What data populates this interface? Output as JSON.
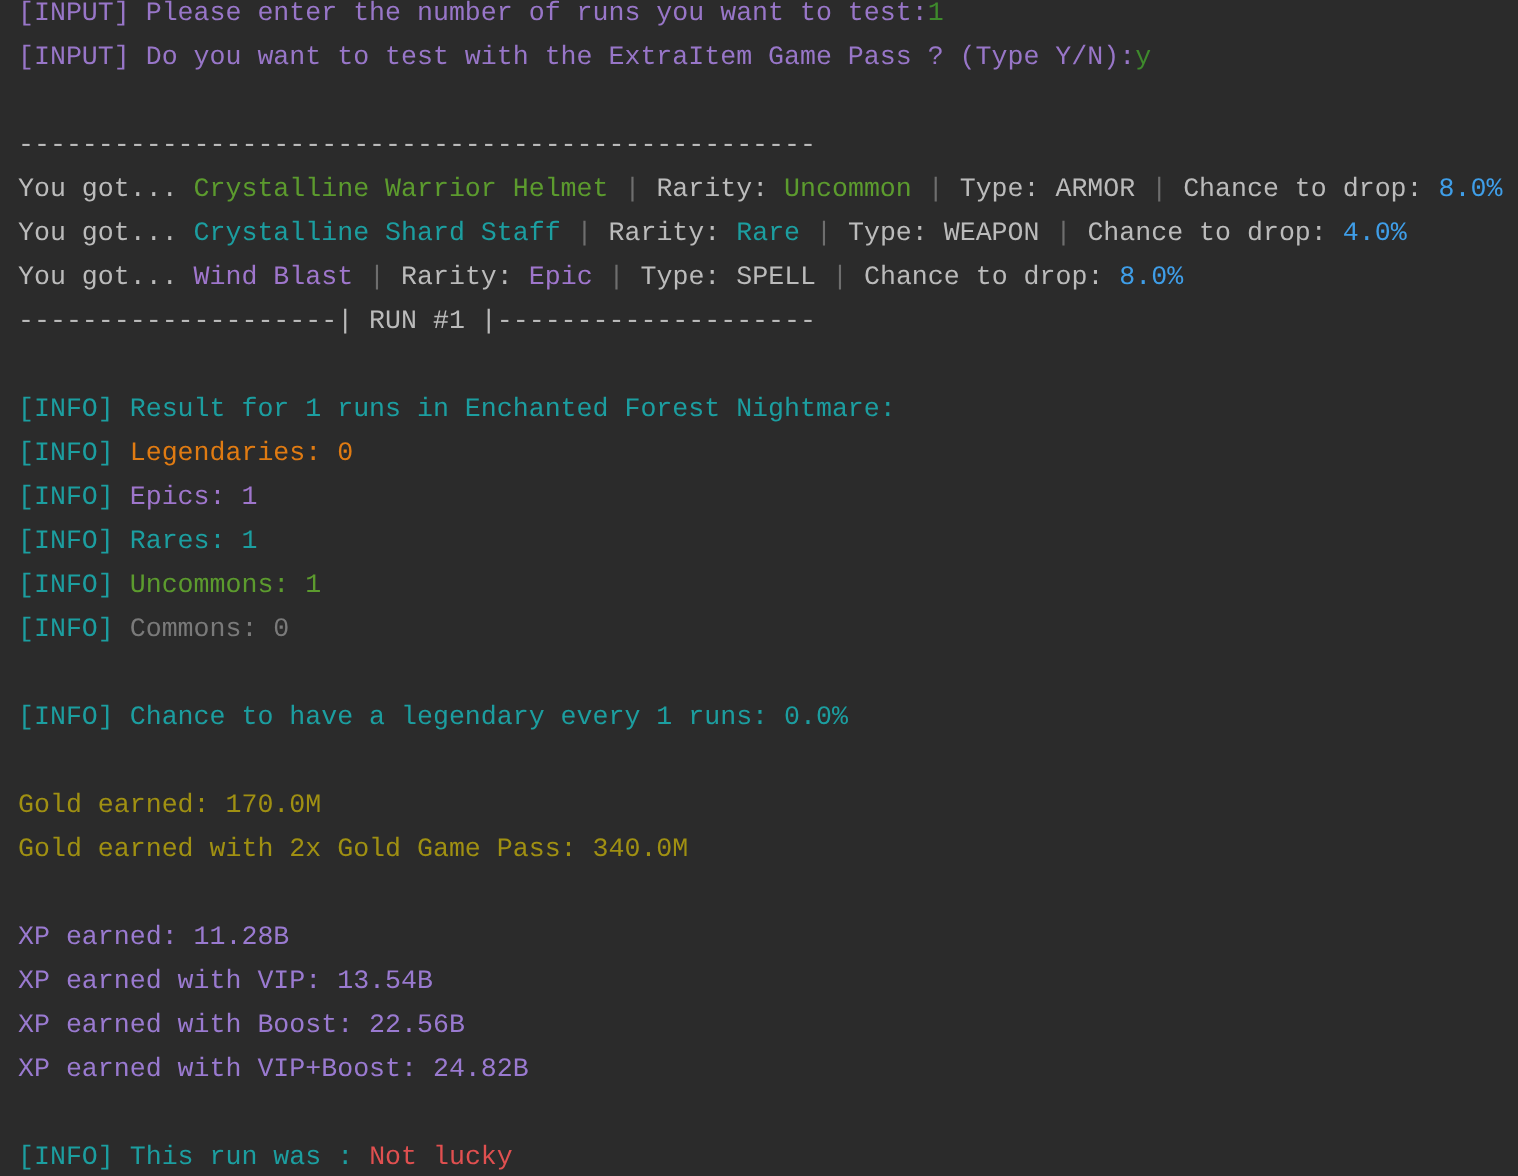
{
  "console": {
    "lines": [
      {
        "kind": "text",
        "segments": [
          {
            "text": "[INPUT] Please enter the number of runs you want to test:",
            "color": "#9876c8"
          },
          {
            "text": "1",
            "color": "#3e8a2c"
          }
        ]
      },
      {
        "kind": "text",
        "segments": [
          {
            "text": "[INPUT] Do you want to test with the ExtraItem Game Pass ? (Type Y/N):",
            "color": "#9876c8"
          },
          {
            "text": "y",
            "color": "#3e8a2c"
          }
        ]
      },
      {
        "kind": "blank"
      },
      {
        "kind": "text",
        "segments": [
          {
            "text": "--------------------------------------------------",
            "color": "#bbbbbb"
          }
        ]
      },
      {
        "kind": "text",
        "segments": [
          {
            "text": "You got... ",
            "color": "#bbbbbb"
          },
          {
            "text": "Crystalline Warrior Helmet",
            "color": "#5c9b2e"
          },
          {
            "text": " | ",
            "color": "#6e6e6e"
          },
          {
            "text": "Rarity: ",
            "color": "#bbbbbb"
          },
          {
            "text": "Uncommon",
            "color": "#5c9b2e"
          },
          {
            "text": " | ",
            "color": "#6e6e6e"
          },
          {
            "text": "Type: ARMOR",
            "color": "#bbbbbb"
          },
          {
            "text": " | ",
            "color": "#6e6e6e"
          },
          {
            "text": "Chance to drop: ",
            "color": "#bbbbbb"
          },
          {
            "text": "8.0%",
            "color": "#3f9ee8"
          }
        ]
      },
      {
        "kind": "text",
        "segments": [
          {
            "text": "You got... ",
            "color": "#bbbbbb"
          },
          {
            "text": "Crystalline Shard Staff",
            "color": "#1c9ea0"
          },
          {
            "text": " | ",
            "color": "#6e6e6e"
          },
          {
            "text": "Rarity: ",
            "color": "#bbbbbb"
          },
          {
            "text": "Rare",
            "color": "#1c9ea0"
          },
          {
            "text": " | ",
            "color": "#6e6e6e"
          },
          {
            "text": "Type: WEAPON",
            "color": "#bbbbbb"
          },
          {
            "text": " | ",
            "color": "#6e6e6e"
          },
          {
            "text": "Chance to drop: ",
            "color": "#bbbbbb"
          },
          {
            "text": "4.0%",
            "color": "#3f9ee8"
          }
        ]
      },
      {
        "kind": "text",
        "segments": [
          {
            "text": "You got... ",
            "color": "#bbbbbb"
          },
          {
            "text": "Wind Blast",
            "color": "#9f76cc"
          },
          {
            "text": " | ",
            "color": "#6e6e6e"
          },
          {
            "text": "Rarity: ",
            "color": "#bbbbbb"
          },
          {
            "text": "Epic",
            "color": "#9f76cc"
          },
          {
            "text": " | ",
            "color": "#6e6e6e"
          },
          {
            "text": "Type: SPELL",
            "color": "#bbbbbb"
          },
          {
            "text": " | ",
            "color": "#6e6e6e"
          },
          {
            "text": "Chance to drop: ",
            "color": "#bbbbbb"
          },
          {
            "text": "8.0%",
            "color": "#3f9ee8"
          }
        ]
      },
      {
        "kind": "text",
        "segments": [
          {
            "text": "--------------------| RUN #1 |--------------------",
            "color": "#bbbbbb"
          }
        ]
      },
      {
        "kind": "blank"
      },
      {
        "kind": "text",
        "segments": [
          {
            "text": "[INFO] Result for 1 runs in Enchanted Forest Nightmare:",
            "color": "#1c9ea0"
          }
        ]
      },
      {
        "kind": "text",
        "segments": [
          {
            "text": "[INFO] ",
            "color": "#1c9ea0"
          },
          {
            "text": "Legendaries: 0",
            "color": "#e07b12"
          }
        ]
      },
      {
        "kind": "text",
        "segments": [
          {
            "text": "[INFO] ",
            "color": "#1c9ea0"
          },
          {
            "text": "Epics: 1",
            "color": "#9f76cc"
          }
        ]
      },
      {
        "kind": "text",
        "segments": [
          {
            "text": "[INFO] ",
            "color": "#1c9ea0"
          },
          {
            "text": "Rares: 1",
            "color": "#1c9ea0"
          }
        ]
      },
      {
        "kind": "text",
        "segments": [
          {
            "text": "[INFO] ",
            "color": "#1c9ea0"
          },
          {
            "text": "Uncommons: 1",
            "color": "#5c9b2e"
          }
        ]
      },
      {
        "kind": "text",
        "segments": [
          {
            "text": "[INFO] ",
            "color": "#1c9ea0"
          },
          {
            "text": "Commons: 0",
            "color": "#7a7a7a"
          }
        ]
      },
      {
        "kind": "blank"
      },
      {
        "kind": "text",
        "segments": [
          {
            "text": "[INFO] Chance to have a legendary every 1 runs: 0.0%",
            "color": "#1c9ea0"
          }
        ]
      },
      {
        "kind": "blank"
      },
      {
        "kind": "text",
        "segments": [
          {
            "text": "Gold earned: 170.0M",
            "color": "#a09012"
          }
        ]
      },
      {
        "kind": "text",
        "segments": [
          {
            "text": "Gold earned with 2x Gold Game Pass: 340.0M",
            "color": "#a09012"
          }
        ]
      },
      {
        "kind": "blank"
      },
      {
        "kind": "text",
        "segments": [
          {
            "text": "XP earned: 11.28B",
            "color": "#9a7ad0"
          }
        ]
      },
      {
        "kind": "text",
        "segments": [
          {
            "text": "XP earned with VIP: 13.54B",
            "color": "#9a7ad0"
          }
        ]
      },
      {
        "kind": "text",
        "segments": [
          {
            "text": "XP earned with Boost: 22.56B",
            "color": "#9a7ad0"
          }
        ]
      },
      {
        "kind": "text",
        "segments": [
          {
            "text": "XP earned with VIP+Boost: 24.82B",
            "color": "#9a7ad0"
          }
        ]
      },
      {
        "kind": "blank"
      },
      {
        "kind": "text",
        "segments": [
          {
            "text": "[INFO] ",
            "color": "#1c9ea0"
          },
          {
            "text": "This run was : ",
            "color": "#1c9ea0"
          },
          {
            "text": "Not lucky",
            "color": "#e05050"
          }
        ]
      }
    ]
  }
}
